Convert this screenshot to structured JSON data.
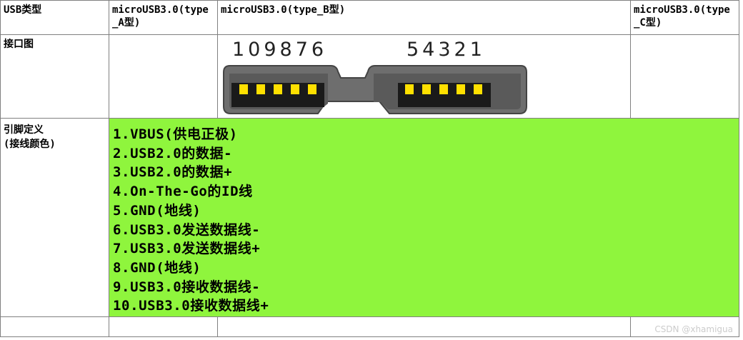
{
  "table": {
    "header": {
      "col0": "USB类型",
      "col1": "microUSB3.0(type_A型)",
      "col2": "microUSB3.0(type_B型)",
      "col3": "microUSB3.0(type_C型)"
    },
    "row_connector": {
      "label": "接口图",
      "left_numbers": "109876",
      "right_numbers": "54321"
    },
    "row_pins": {
      "label_line1": "引脚定义",
      "label_line2": "(接线颜色)",
      "pins": [
        "1.VBUS(供电正极)",
        "2.USB2.0的数据-",
        "3.USB2.0的数据+",
        "4.On-The-Go的ID线",
        "5.GND(地线)",
        "6.USB3.0发送数据线-",
        "7.USB3.0发送数据线+",
        "8.GND(地线)",
        "9.USB3.0接收数据线-",
        "10.USB3.0接收数据线+"
      ]
    }
  },
  "watermark": "CSDN @xhamigua",
  "colors": {
    "highlight": "#8ff53d",
    "connector_body": "#6e6e6e",
    "pin_contact": "#ffe000"
  }
}
